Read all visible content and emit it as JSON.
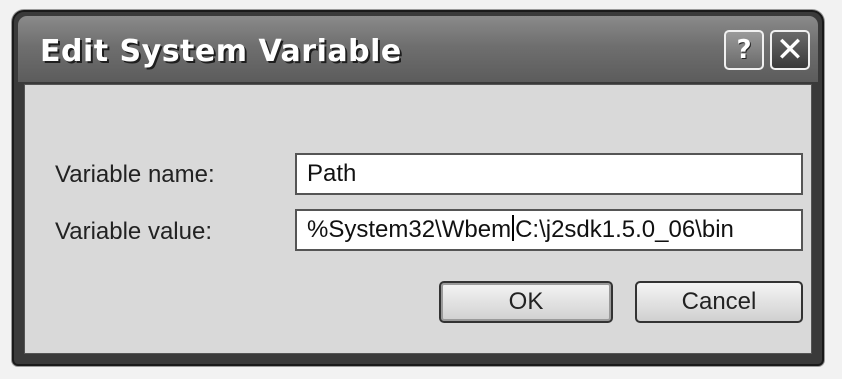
{
  "window": {
    "title": "Edit System Variable",
    "help_symbol": "?",
    "close_symbol": "✕"
  },
  "form": {
    "name_label": "Variable name:",
    "name_value": "Path",
    "value_label": "Variable value:",
    "value_before_caret": "%System32\\Wbem",
    "value_after_caret": "C:\\j2sdk1.5.0_06\\bin"
  },
  "buttons": {
    "ok_label": "OK",
    "cancel_label": "Cancel"
  }
}
